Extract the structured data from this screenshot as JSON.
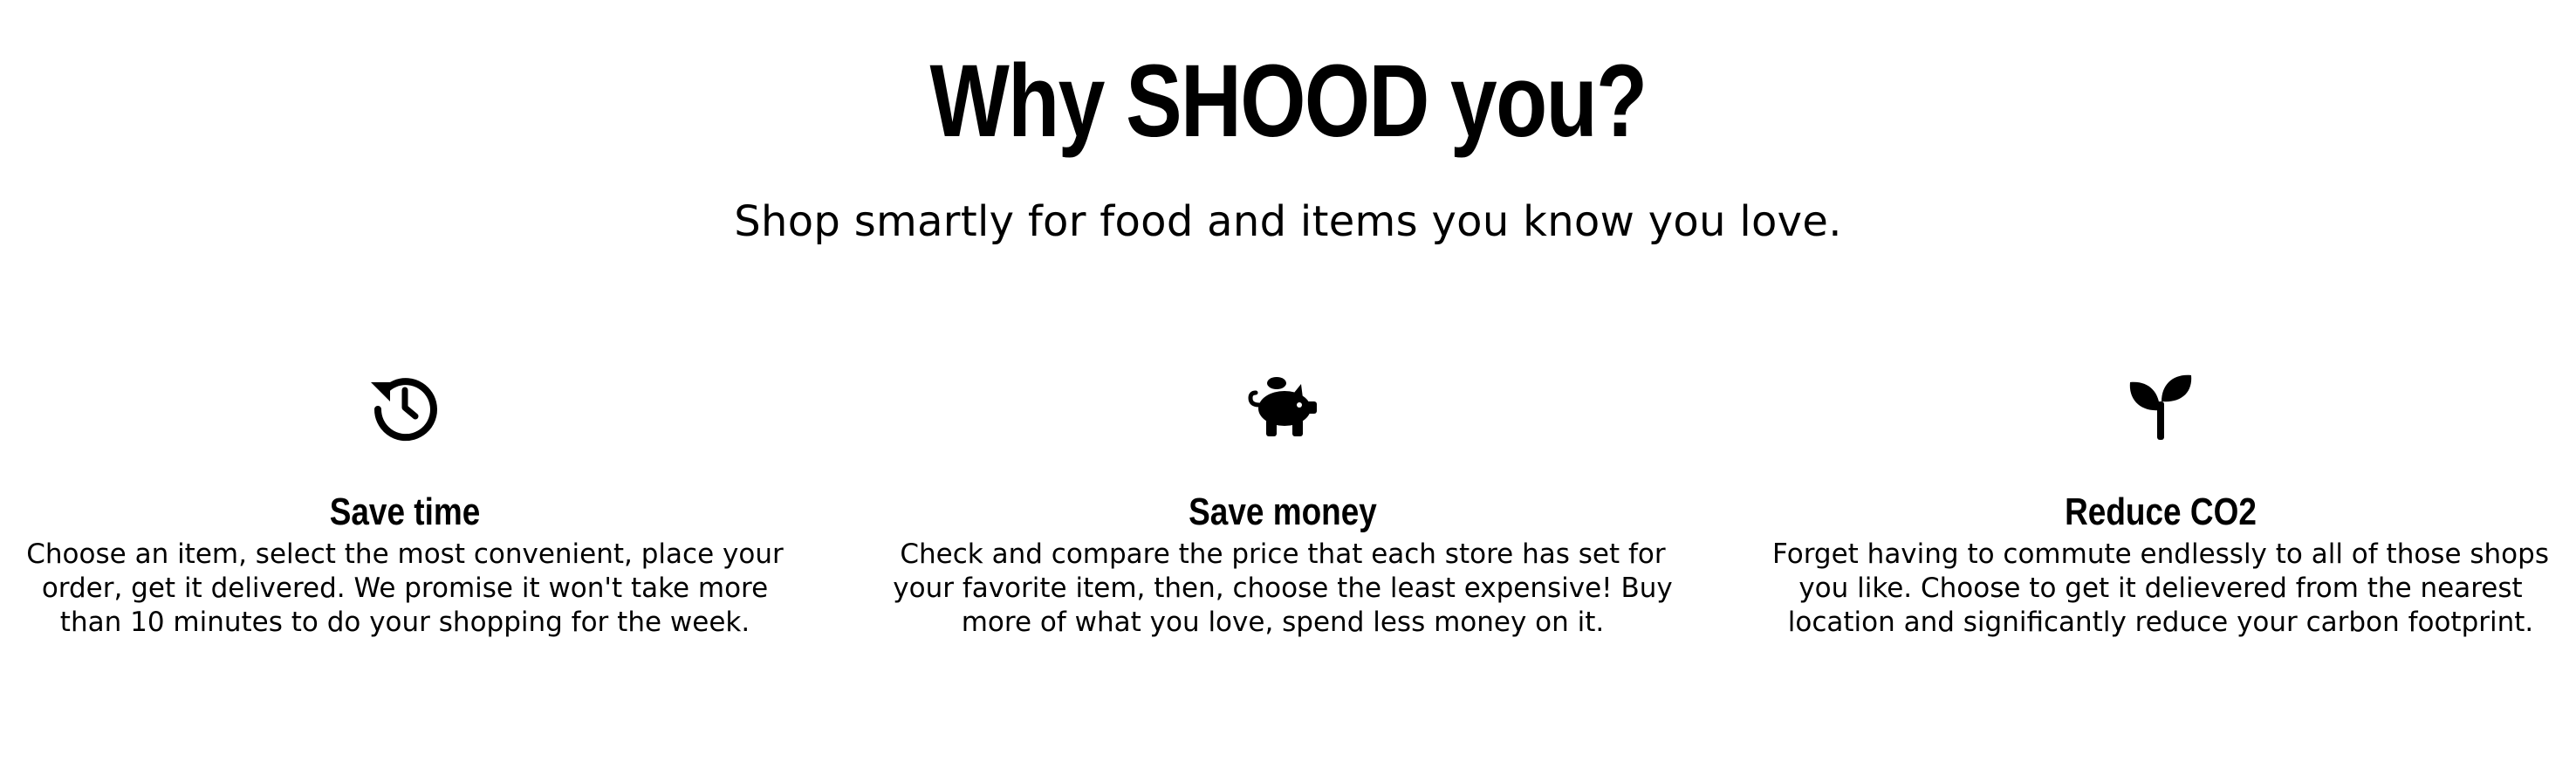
{
  "header": {
    "title": "Why SHOOD you?",
    "subtitle": "Shop smartly for food and items you know you love."
  },
  "features": [
    {
      "icon": "history-icon",
      "title": "Save time",
      "description": "Choose an item, select the most convenient, place your\norder, get it delivered. We promise it won't take more\nthan 10 minutes to do your shopping for the week."
    },
    {
      "icon": "piggy-bank-icon",
      "title": "Save money",
      "description": "Check and compare the price that each store has set for\nyour favorite item, then, choose the least expensive! Buy\nmore of what you love, spend less money on it."
    },
    {
      "icon": "seedling-icon",
      "title": "Reduce CO2",
      "description": "Forget having to commute endlessly to all of those shops\nyou like. Choose to get it delievered from the nearest\nlocation and significantly reduce your carbon footprint."
    }
  ],
  "colors": {
    "text": "#000000",
    "background": "#ffffff"
  }
}
